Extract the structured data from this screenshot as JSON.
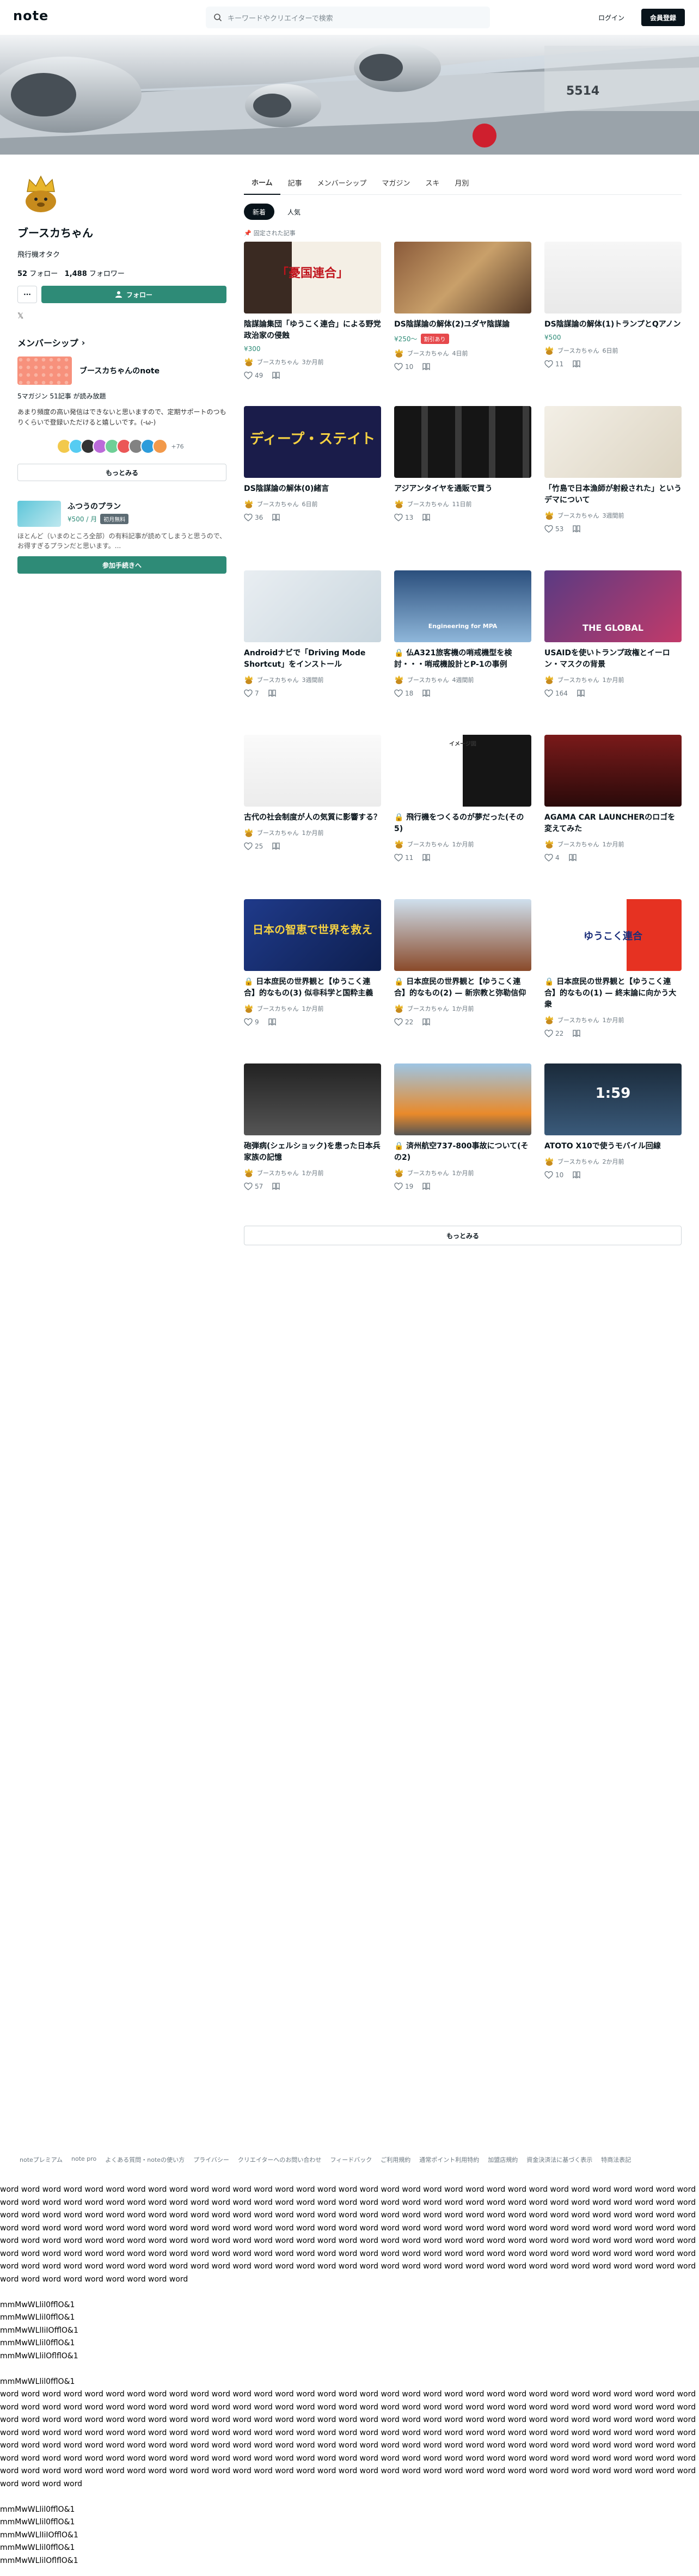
{
  "header": {
    "logo": "note",
    "search_placeholder": "キーワードやクリエイターで検索",
    "login_label": "ログイン",
    "signup_label": "会員登録"
  },
  "banner": {
    "tail_number": "5514"
  },
  "profile": {
    "name": "ブースカちゃん",
    "description": "飛行機オタク",
    "following_count": "52",
    "following_label": "フォロー",
    "follower_count": "1,488",
    "follower_label": "フォロワー",
    "more_label": "···",
    "follow_label": "フォロー",
    "x_link": "𝕏"
  },
  "membership": {
    "title": "メンバーシップ",
    "name": "ブースカちゃんのnote",
    "stats": "5マガジン 51記事 が読み放題",
    "description": "あまり頻度の高い発信はできないと思いますので、定期サポートのつもりくらいで登録いただけると嬉しいです。(-ω-)",
    "member_count": "+76",
    "see_more": "もっとみる"
  },
  "plan": {
    "name": "ふつうのプラン",
    "price": "¥500 / 月",
    "badge": "初月無料",
    "description": "ほとんど（いまのところ全部）の有料記事が読めてしまうと思うので、お得すぎるプランだと思います。...",
    "join_label": "参加手続きへ"
  },
  "tabs": [
    "ホーム",
    "記事",
    "メンバーシップ",
    "マガジン",
    "スキ",
    "月別"
  ],
  "chips": [
    "新着",
    "人気"
  ],
  "pinned_label": "固定された記事",
  "articles": [
    {
      "title": "陰謀論集団「ゆうこく連合」による野党政治家の侵蝕",
      "price": "¥300",
      "badge": "",
      "author": "ブースカちゃん",
      "time": "3か月前",
      "likes": "49",
      "thumb_text": "「憂国連合」"
    },
    {
      "title": "DS陰謀論の解体(2)ユダヤ陰謀論",
      "price": "¥250〜",
      "badge": "割引あり",
      "author": "ブースカちゃん",
      "time": "4日前",
      "likes": "10",
      "thumb_text": ""
    },
    {
      "title": "DS陰謀論の解体(1)トランプとQアノン",
      "price": "¥500",
      "badge": "",
      "author": "ブースカちゃん",
      "time": "6日前",
      "likes": "11",
      "thumb_text": ""
    },
    {
      "title": "DS陰謀論の解体(0)緒言",
      "price": "",
      "badge": "",
      "author": "ブースカちゃん",
      "time": "6日前",
      "likes": "36",
      "thumb_text": "ディープ・ステイト"
    },
    {
      "title": "アジアンタイヤを通販で買う",
      "price": "",
      "badge": "",
      "author": "ブースカちゃん",
      "time": "11日前",
      "likes": "13",
      "thumb_text": ""
    },
    {
      "title": "「竹島で日本漁師が射殺された」というデマについて",
      "price": "",
      "badge": "",
      "author": "ブースカちゃん",
      "time": "3週間前",
      "likes": "53",
      "thumb_text": ""
    },
    {
      "title": "Androidナビで「Driving Mode Shortcut」をインストール",
      "price": "",
      "badge": "",
      "author": "ブースカちゃん",
      "time": "3週間前",
      "likes": "7",
      "thumb_text": ""
    },
    {
      "title": "🔒 仏A321旅客機の哨戒機型を検討・・・哨戒機設計とP-1の事例",
      "price": "",
      "badge": "",
      "author": "ブースカちゃん",
      "time": "4週間前",
      "likes": "18",
      "thumb_text": "Engineering for MPA"
    },
    {
      "title": "USAIDを使いトランプ政権とイーロン・マスクの背景",
      "price": "",
      "badge": "",
      "author": "ブースカちゃん",
      "time": "1か月前",
      "likes": "164",
      "thumb_text": "THE GLOBAL"
    },
    {
      "title": "古代の社会制度が人の気質に影響する？",
      "price": "",
      "badge": "",
      "author": "ブースカちゃん",
      "time": "1か月前",
      "likes": "25",
      "thumb_text": ""
    },
    {
      "title": "🔒 飛行機をつくるのが夢だった(その5)",
      "price": "",
      "badge": "",
      "author": "ブースカちゃん",
      "time": "1か月前",
      "likes": "11",
      "thumb_text": "イメージ図"
    },
    {
      "title": "AGAMA CAR LAUNCHERのロゴを変えてみた",
      "price": "",
      "badge": "",
      "author": "ブースカちゃん",
      "time": "1か月前",
      "likes": "4",
      "thumb_text": ""
    },
    {
      "title": "🔒 日本庶民の世界観と【ゆうこく連合】的なもの(3) 似非科学と国粋主義",
      "price": "",
      "badge": "",
      "author": "ブースカちゃん",
      "time": "1か月前",
      "likes": "9",
      "thumb_text": "日本の智恵で世界を救え"
    },
    {
      "title": "🔒 日本庶民の世界観と【ゆうこく連合】的なもの(2) — 新宗教と弥勒信仰",
      "price": "",
      "badge": "",
      "author": "ブースカちゃん",
      "time": "1か月前",
      "likes": "22",
      "thumb_text": ""
    },
    {
      "title": "🔒 日本庶民の世界観と【ゆうこく連合】的なもの(1) — 終末論に向かう大衆",
      "price": "",
      "badge": "",
      "author": "ブースカちゃん",
      "time": "1か月前",
      "likes": "22",
      "thumb_text": "ゆうこく連合"
    },
    {
      "title": "砲弾病(シェルショック)を患った日本兵　家族の記憶",
      "price": "",
      "badge": "",
      "author": "ブースカちゃん",
      "time": "1か月前",
      "likes": "57",
      "thumb_text": ""
    },
    {
      "title": "🔒 済州航空737-800事故について(その2)",
      "price": "",
      "badge": "",
      "author": "ブースカちゃん",
      "time": "1か月前",
      "likes": "19",
      "thumb_text": ""
    },
    {
      "title": "ATOTO X10で使うモバイル回線",
      "price": "",
      "badge": "",
      "author": "ブースカちゃん",
      "time": "2か月前",
      "likes": "10",
      "thumb_text": "1:59"
    }
  ],
  "more_label": "もっとみる",
  "footer": [
    "noteプレミアム",
    "note pro",
    "よくある質問・noteの使い方",
    "プライバシー",
    "クリエイターへのお問い合わせ",
    "フィードバック",
    "ご利用規約",
    "通常ポイント利用特約",
    "加盟店規約",
    "資金決済法に基づく表示",
    "特商法表記"
  ],
  "dump_text": "word word word word word word word word word word word word word word word word word word word word word word word word word word word word word word word word word word word word word word word word word word word word word word word word word word word word word word word word word word word word word word word word word word word word word word word word word word word word word word word word word word word word word word word word word word word word word word word word word word word word word word word word word word word word word word word word word word word word word word word word word word word word word word word word word word word word word word word word word word word word word word word word word word word word word word word word word word word word word word word word word word word word word word word word word word word word word word word word word word word word word word word word word word word word word word word word word word word word word word word word word word word word word word word word word word word word word word word word word word word word word word word word word word word word word word word word word word word word word word word word\n\nmmMwWLlil0fflO&1\nmmMwWLlil0fflO&1\nmmMwWLlIiIOfflO&1\nmmMwWLlil0fflO&1\nmmMwWLlilOflflO&1\n\nmmMwWLlil0fflO&1\nword word word word word word word word word word word word word word word word word word word word word word word word word word word word word word word word word word word word word word word word word word word word word word word word word word word word word word word word word word word word word word word word word word word word word word word word word word word word word word word word word word word word word word word word word word word word word word word word word word word word word word word word word word word word word word word word word word word word word word word word word word word word word word word word word word word word word word word word word word word word word word word word word word word word word word word word word word word word word word word word word word word word word word word word word word word word word word word word word word word word word word word word word word word word word word word word word word word word word word word word word word word word word word word word word word word word word word word word word word word word word word word word word word word word word word word word word word word\n\nmmMwWLlil0fflO&1\nmmMwWLlil0fflO&1\nmmMwWLlIiIOfflO&1\nmmMwWLlil0fflO&1\nmmMwWLlilOflflO&1\n\nmmMwWLlil0fflO&1"
}
